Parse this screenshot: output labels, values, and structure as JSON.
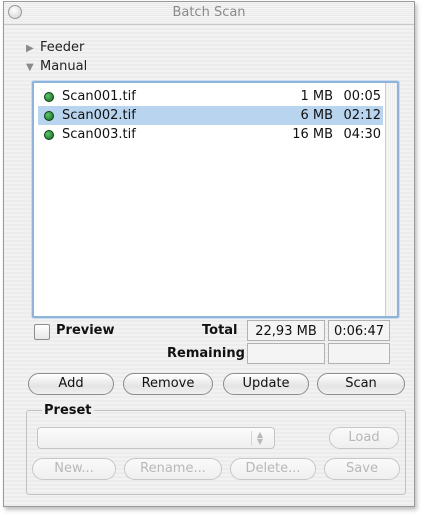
{
  "window": {
    "title": "Batch Scan"
  },
  "sections": {
    "feeder_label": "Feeder",
    "manual_label": "Manual"
  },
  "files": [
    {
      "name": "Scan001.tif",
      "size": "1 MB",
      "time": "00:05",
      "selected": false
    },
    {
      "name": "Scan002.tif",
      "size": "6 MB",
      "time": "02:12",
      "selected": true
    },
    {
      "name": "Scan003.tif",
      "size": "16 MB",
      "time": "04:30",
      "selected": false
    }
  ],
  "summary": {
    "preview_label": "Preview",
    "preview_checked": false,
    "total_label": "Total",
    "total_size": "22,93 MB",
    "total_time": "0:06:47",
    "remaining_label": "Remaining",
    "remaining_size": "",
    "remaining_time": ""
  },
  "actions": {
    "add": "Add",
    "remove": "Remove",
    "update": "Update",
    "scan": "Scan"
  },
  "preset": {
    "label": "Preset",
    "selected": "",
    "load": "Load",
    "new": "New...",
    "rename": "Rename...",
    "delete": "Delete...",
    "save": "Save"
  },
  "colors": {
    "selection": "#b9d4ee",
    "status_dot": "#1c8a2b",
    "list_focus_border": "#8fb3d9"
  },
  "icons": {
    "status": "green-status-dot-icon",
    "collapsed": "disclosure-right-icon",
    "expanded": "disclosure-down-icon"
  }
}
